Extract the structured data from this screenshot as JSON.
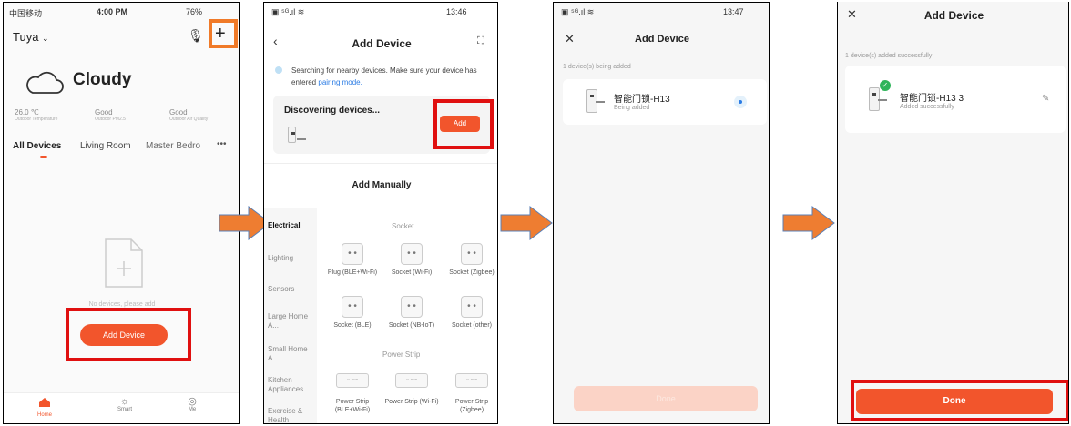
{
  "colors": {
    "accent": "#f2552c",
    "highlight_red": "#e01010",
    "highlight_orange": "#f07a28",
    "arrow": "#ee7d31"
  },
  "screen1": {
    "status_carrier": "中国移动",
    "status_time": "4:00 PM",
    "status_battery": "76%",
    "home_name": "Tuya",
    "weather": "Cloudy",
    "stats": [
      {
        "value": "26.0 ℃",
        "label": "Outdoor Temperature"
      },
      {
        "value": "Good",
        "label": "Outdoor PM2.5"
      },
      {
        "value": "Good",
        "label": "Outdoor Air Quality"
      }
    ],
    "tabs": [
      "All Devices",
      "Living Room",
      "Master Bedro"
    ],
    "empty_text": "No devices, please add",
    "add_button": "Add Device",
    "nav": [
      "Home",
      "Smart",
      "Me"
    ]
  },
  "screen2": {
    "status_time": "13:46",
    "title": "Add Device",
    "info_text": "Searching for nearby devices. Make sure your device has entered",
    "info_link": "pairing mode.",
    "discover_title": "Discovering devices...",
    "add_button": "Add",
    "manual_title": "Add Manually",
    "categories": [
      "Electrical",
      "Lighting",
      "Sensors",
      "Large Home A...",
      "Small Home A...",
      "Kitchen Appliances",
      "Exercise & Health"
    ],
    "section_socket": "Socket",
    "section_power_strip": "Power Strip",
    "socket_items": [
      "Plug (BLE+Wi-Fi)",
      "Socket (Wi-Fi)",
      "Socket (Zigbee)",
      "Socket (BLE)",
      "Socket (NB-IoT)",
      "Socket (other)"
    ],
    "strip_items": [
      "Power Strip (BLE+Wi-Fi)",
      "Power Strip (Wi-Fi)",
      "Power Strip (Zigbee)"
    ]
  },
  "screen3": {
    "status_time": "13:47",
    "title": "Add Device",
    "subtitle": "1 device(s) being added",
    "device_name": "智能门锁-H13",
    "device_status": "Being added",
    "bottom_button": "Done"
  },
  "screen4": {
    "title": "Add Device",
    "subtitle": "1 device(s) added successfully",
    "device_name": "智能门锁-H13 3",
    "device_status": "Added successfully",
    "done_button": "Done"
  }
}
